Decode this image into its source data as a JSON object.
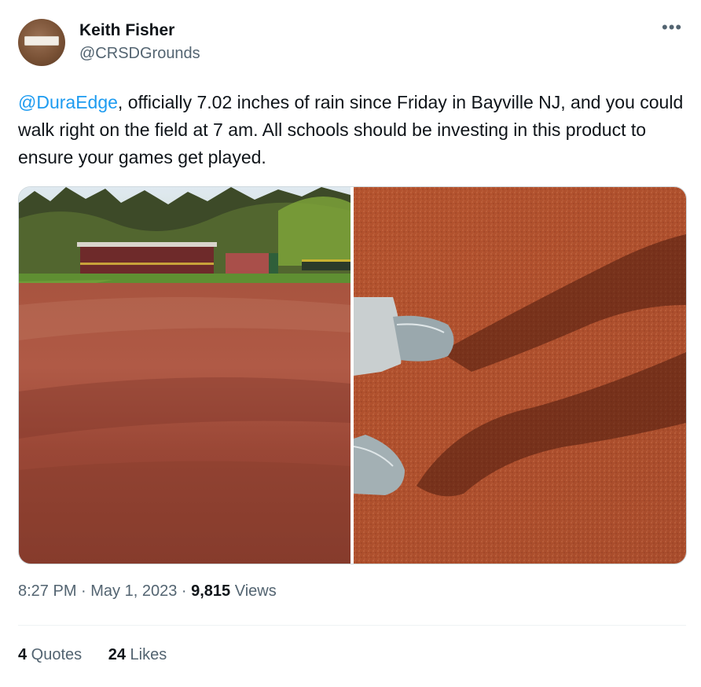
{
  "author": {
    "display_name": "Keith Fisher",
    "handle": "@CRSDGrounds"
  },
  "more_icon": "more-horizontal-icon",
  "tweet": {
    "mention": "@DuraEdge",
    "text": ", officially 7.02 inches of rain since Friday in Bayville NJ, and you could walk right on the field at 7 am. All schools should be investing in this product to ensure your games get played."
  },
  "media": {
    "left_photo": "baseball infield with dugouts and trees",
    "right_photo": "sneakers standing on red clay surface with shadows"
  },
  "meta": {
    "time": "8:27 PM",
    "sep1": " · ",
    "date": "May 1, 2023",
    "sep2": " · ",
    "views_count": "9,815",
    "views_label": " Views"
  },
  "stats": {
    "quotes_count": "4",
    "quotes_label": " Quotes",
    "likes_count": "24",
    "likes_label": " Likes"
  },
  "colors": {
    "link": "#1d9bf0",
    "secondary_text": "#536471",
    "primary_text": "#0f1419"
  }
}
